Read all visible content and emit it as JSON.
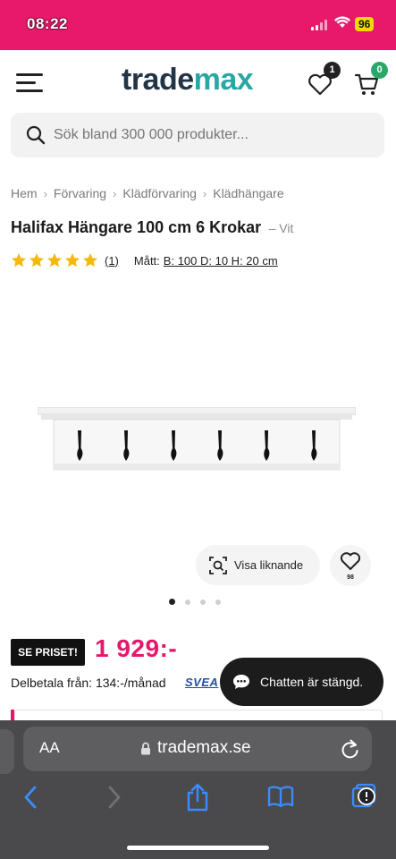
{
  "status_bar": {
    "time": "08:22",
    "battery": "96",
    "background": "#e8196b"
  },
  "header": {
    "logo_part1": "trade",
    "logo_part2": "max",
    "wishlist_count": "1",
    "cart_count": "0",
    "menu_icon": "menu-icon",
    "wishlist_icon": "heart-icon",
    "cart_icon": "cart-icon"
  },
  "search": {
    "placeholder": "Sök bland 300 000 produkter..."
  },
  "breadcrumb": [
    "Hem",
    "Förvaring",
    "Klädförvaring",
    "Klädhängare"
  ],
  "product": {
    "title": "Halifax Hängare 100 cm 6 Krokar",
    "color": "– Vit",
    "rating": 5,
    "review_count": "(1)",
    "dims_label": "Mått:",
    "dims_value": "B: 100 D: 10 H: 20 cm",
    "similar_label": "Visa liknande",
    "favorites_count": "98",
    "image_count": 4,
    "active_image": 1
  },
  "price": {
    "badge": "SE PRISET!",
    "amount": "1 929:-",
    "installment": "Delbetala från: 134:-/månad",
    "provider": "SVEA",
    "accent_color": "#e5186c"
  },
  "chat": {
    "label": "Chatten är stängd."
  },
  "browser": {
    "aa_label": "AA",
    "url": "trademax.se",
    "toolbar_icons": [
      "back-icon",
      "forward-icon",
      "share-icon",
      "bookmarks-icon",
      "tabs-icon"
    ]
  }
}
